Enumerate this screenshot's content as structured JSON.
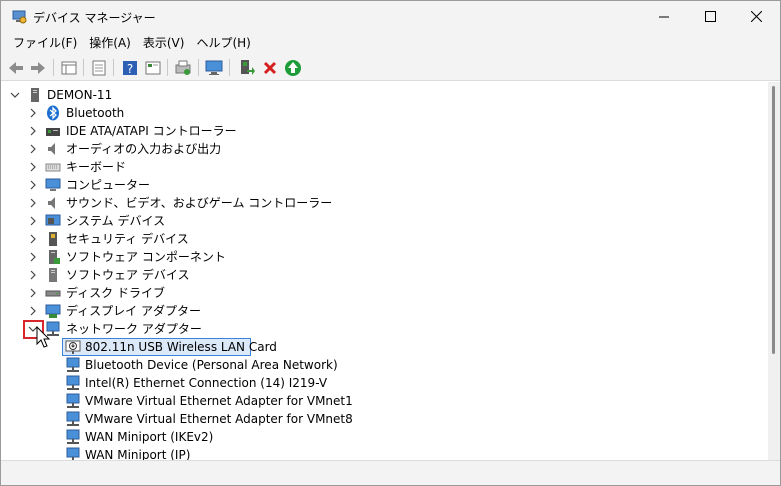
{
  "window": {
    "title": "デバイス マネージャー"
  },
  "menu": [
    {
      "label": "ファイル(F)"
    },
    {
      "label": "操作(A)"
    },
    {
      "label": "表示(V)"
    },
    {
      "label": "ヘルプ(H)"
    }
  ],
  "tree": {
    "root": "DEMON-11",
    "categories": [
      {
        "label": "Bluetooth",
        "icon": "bluetooth-icon"
      },
      {
        "label": "IDE ATA/ATAPI コントローラー",
        "icon": "ide-controller-icon"
      },
      {
        "label": "オーディオの入力および出力",
        "icon": "speaker-icon"
      },
      {
        "label": "キーボード",
        "icon": "keyboard-icon"
      },
      {
        "label": "コンピューター",
        "icon": "computer-icon"
      },
      {
        "label": "サウンド、ビデオ、およびゲーム コントローラー",
        "icon": "speaker-icon"
      },
      {
        "label": "システム デバイス",
        "icon": "system-device-icon"
      },
      {
        "label": "セキュリティ デバイス",
        "icon": "security-device-icon"
      },
      {
        "label": "ソフトウェア コンポーネント",
        "icon": "software-component-icon"
      },
      {
        "label": "ソフトウェア デバイス",
        "icon": "software-device-icon"
      },
      {
        "label": "ディスク ドライブ",
        "icon": "disk-drive-icon"
      },
      {
        "label": "ディスプレイ アダプター",
        "icon": "display-adapter-icon"
      },
      {
        "label": "ネットワーク アダプター",
        "icon": "network-adapter-icon"
      }
    ],
    "network_children": [
      {
        "label": "802.11n USB Wireless LAN Card"
      },
      {
        "label": "Bluetooth Device (Personal Area Network)"
      },
      {
        "label": "Intel(R) Ethernet Connection (14) I219-V"
      },
      {
        "label": "VMware Virtual Ethernet Adapter for VMnet1"
      },
      {
        "label": "VMware Virtual Ethernet Adapter for VMnet8"
      },
      {
        "label": "WAN Miniport (IKEv2)"
      },
      {
        "label": "WAN Miniport (IP)"
      }
    ]
  },
  "colors": {
    "highlight": "#d9262c",
    "selection": "#dbe9f9",
    "accent": "#3a83d9"
  }
}
